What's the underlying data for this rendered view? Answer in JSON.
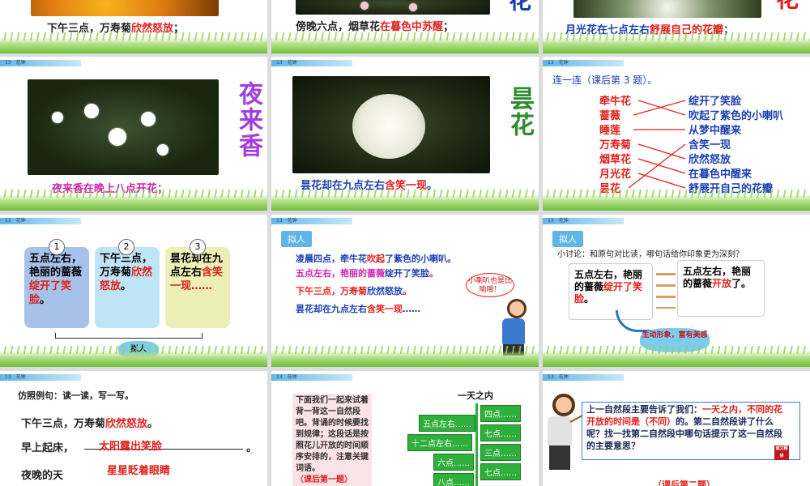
{
  "header_label": "13　花钟",
  "slides": {
    "s1": {
      "caption_a": "下午三点，万寿菊",
      "caption_b": "欣然怒放",
      "caption_c": "；"
    },
    "s2": {
      "caption_a": "傍晚六点，烟草花",
      "caption_b": "在暮色中苏醒",
      "caption_c": "；",
      "big": "花"
    },
    "s3": {
      "caption_a": "月光花在七点左右",
      "caption_b": "舒展自己的花瓣",
      "caption_c": "；",
      "big": "花"
    },
    "s4": {
      "big": "夜来香",
      "caption_a": "夜来香在晚上八点开花；"
    },
    "s5": {
      "big": "昙花",
      "caption_a": "昙花却在九点左右",
      "caption_b": "含笑一现",
      "caption_c": "。"
    },
    "s6": {
      "title": "连一连（课后第 3 题）。",
      "left": [
        "牵牛花",
        "蔷薇",
        "睡莲",
        "万寿菊",
        "烟草花",
        "月光花",
        "昙花"
      ],
      "right": [
        "绽开了笑脸",
        "吹起了紫色的小喇叭",
        "从梦中醒来",
        "含笑一现",
        "欣然怒放",
        "在暮色中醒来",
        "舒展开自己的花瓣"
      ]
    },
    "s7": {
      "nums": [
        "1",
        "2",
        "3"
      ],
      "card1_a": "五点左右，艳丽的蔷薇",
      "card1_b": "绽开了笑脸",
      "card1_c": "。",
      "card2_a": "下午三点，万寿菊",
      "card2_b": "欣然怒放",
      "card2_c": "。",
      "card3_a": "昙花却在九点左右",
      "card3_b": "含笑一现……",
      "cloud": "拟人"
    },
    "s8": {
      "tag": "拟人",
      "line1_a": "凌晨四点，牵牛花",
      "line1_b": "吹起",
      "line1_c": "了紫色的小喇叭。",
      "line2_a": "五点左右，艳丽的蔷薇",
      "line2_b": "绽开了笑脸",
      "line2_c": "。",
      "line3_a": "下午三点，万寿菊",
      "line3_b": "欣然怒放",
      "line3_c": "。",
      "line4_a": "昙花却在九点左右",
      "line4_b": "含笑一现",
      "line4_c": "……",
      "bubble": "小喇叭也是比喻哦！"
    },
    "s9": {
      "tag": "拟人",
      "question": "小讨论：和原句对比读，哪句话给你印象更为深刻？",
      "left_a": "五点左右，艳丽的蔷薇",
      "left_b": "绽开了笑脸",
      "left_c": "。",
      "right_a": "五点左右，艳丽的蔷薇",
      "right_b": "开放",
      "right_c": "了。",
      "cloud": "生动形象，富有美感"
    },
    "s10": {
      "title": "仿照例句：读一读，写一写。",
      "ex_a": "下午三点，万寿菊",
      "ex_b": "欣然怒放",
      "ex_c": "。",
      "q1": "早上起床，",
      "a1": "太阳露出笑脸",
      "q1_end": "。",
      "q2": "夜晚的天",
      "a2": "星星眨着眼睛"
    },
    "s11": {
      "note": "下面我们一起来试着背一背这一自然段吧。背诵的时候要找到规律；这段话是按照花儿开放的时间顺序安排的，注意关键词语。",
      "note_tail": "（课后第一题）",
      "title": "一天之内",
      "left_boxes": [
        "五点左右……",
        "十二点左右……",
        "六点……",
        "八点……"
      ],
      "right_boxes": [
        "四点……",
        "七点……",
        "三点……",
        "七点……"
      ]
    },
    "s12": {
      "text_a": "上一自然段主要告诉了我们：",
      "text_b": "一天之内，不同的花开放的时间是",
      "text_c": "（不同）",
      "text_d": "的。第二自然段讲了什么呢？找一找第二自然段中哪句话提示了这一自然段的主要意思？",
      "stamp": "课文精读",
      "footer": "（课后第二题）"
    }
  },
  "colors": {
    "red": "#e0201c",
    "blue": "#1b3fb0",
    "magenta": "#d01fb0",
    "purple": "#a33de0",
    "green": "#2e8b2e",
    "grass": "#6cbf3a"
  }
}
